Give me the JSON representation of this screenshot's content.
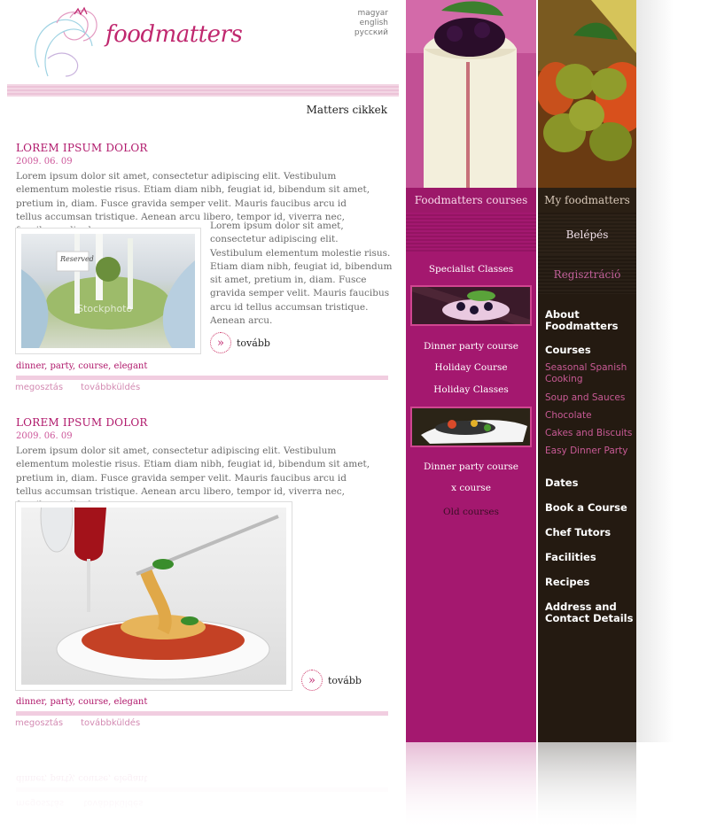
{
  "logo": {
    "text": "foodmatters"
  },
  "languages": [
    "magyar",
    "english",
    "русский"
  ],
  "section_title": "Matters cikkek",
  "articles": [
    {
      "title": "LOREM IPSUM DOLOR",
      "date": "2009. 06. 09",
      "lead": "Lorem ipsum dolor sit amet, consectetur adipiscing elit. Vestibulum elementum molestie risus. Etiam diam nibh, feugiat id, bibendum sit amet, pretium in, diam. Fusce gravida semper velit. Mauris faucibus arcu id tellus accumsan tristique. Aenean arcu libero, tempor id, viverra nec, faucibus a, ligula.",
      "side": "Lorem ipsum dolor sit amet, consectetur adipiscing elit. Vestibulum elementum molestie risus. Etiam diam nibh, feugiat id, bibendum sit amet, pretium in, diam. Fusce gravida semper velit. Mauris faucibus arcu id tellus accumsan tristique. Aenean arcu.",
      "image_watermark": "iStockphoto",
      "image_card": "Reserved",
      "more": "tovább",
      "tags": "dinner, party, course, elegant",
      "share": "megosztás",
      "forward": "továbbküldés"
    },
    {
      "title": "LOREM IPSUM DOLOR",
      "date": "2009. 06. 09",
      "lead": "Lorem ipsum dolor sit amet, consectetur adipiscing elit. Vestibulum elementum molestie risus. Etiam diam nibh, feugiat id, bibendum sit amet, pretium in, diam. Fusce gravida semper velit. Mauris faucibus arcu id tellus accumsan tristique. Aenean arcu libero, tempor id, viverra nec, faucibus a, ligula.",
      "more": "tovább",
      "tags": "dinner, party, course, elegant",
      "share": "megosztás",
      "forward": "továbbküldés"
    }
  ],
  "courses": {
    "header": "Foodmatters courses",
    "items": [
      "Specialist Classes",
      "Dinner party course",
      "Holiday Course",
      "Holiday Classes",
      "Dinner party course",
      "x course",
      "Old courses"
    ]
  },
  "myfm": {
    "header": "My foodmatters",
    "login": "Belépés",
    "register": "Regisztráció",
    "nav": {
      "about": "About Foodmatters",
      "courses": "Courses",
      "subcourses": [
        "Seasonal Spanish Cooking",
        "Soup and Sauces",
        "Chocolate",
        "Cakes and Biscuits",
        "Easy Dinner Party"
      ],
      "dates": "Dates",
      "book": "Book a Course",
      "tutors": "Chef Tutors",
      "facilities": "Facilities",
      "recipes": "Recipes",
      "address": "Address and Contact Details"
    }
  },
  "colors": {
    "accent": "#b0186b",
    "courses_bg": "#a4186f",
    "nav_bg": "#241a11"
  },
  "icons": [
    "logo-flower-icon",
    "more-arrow-icon"
  ]
}
